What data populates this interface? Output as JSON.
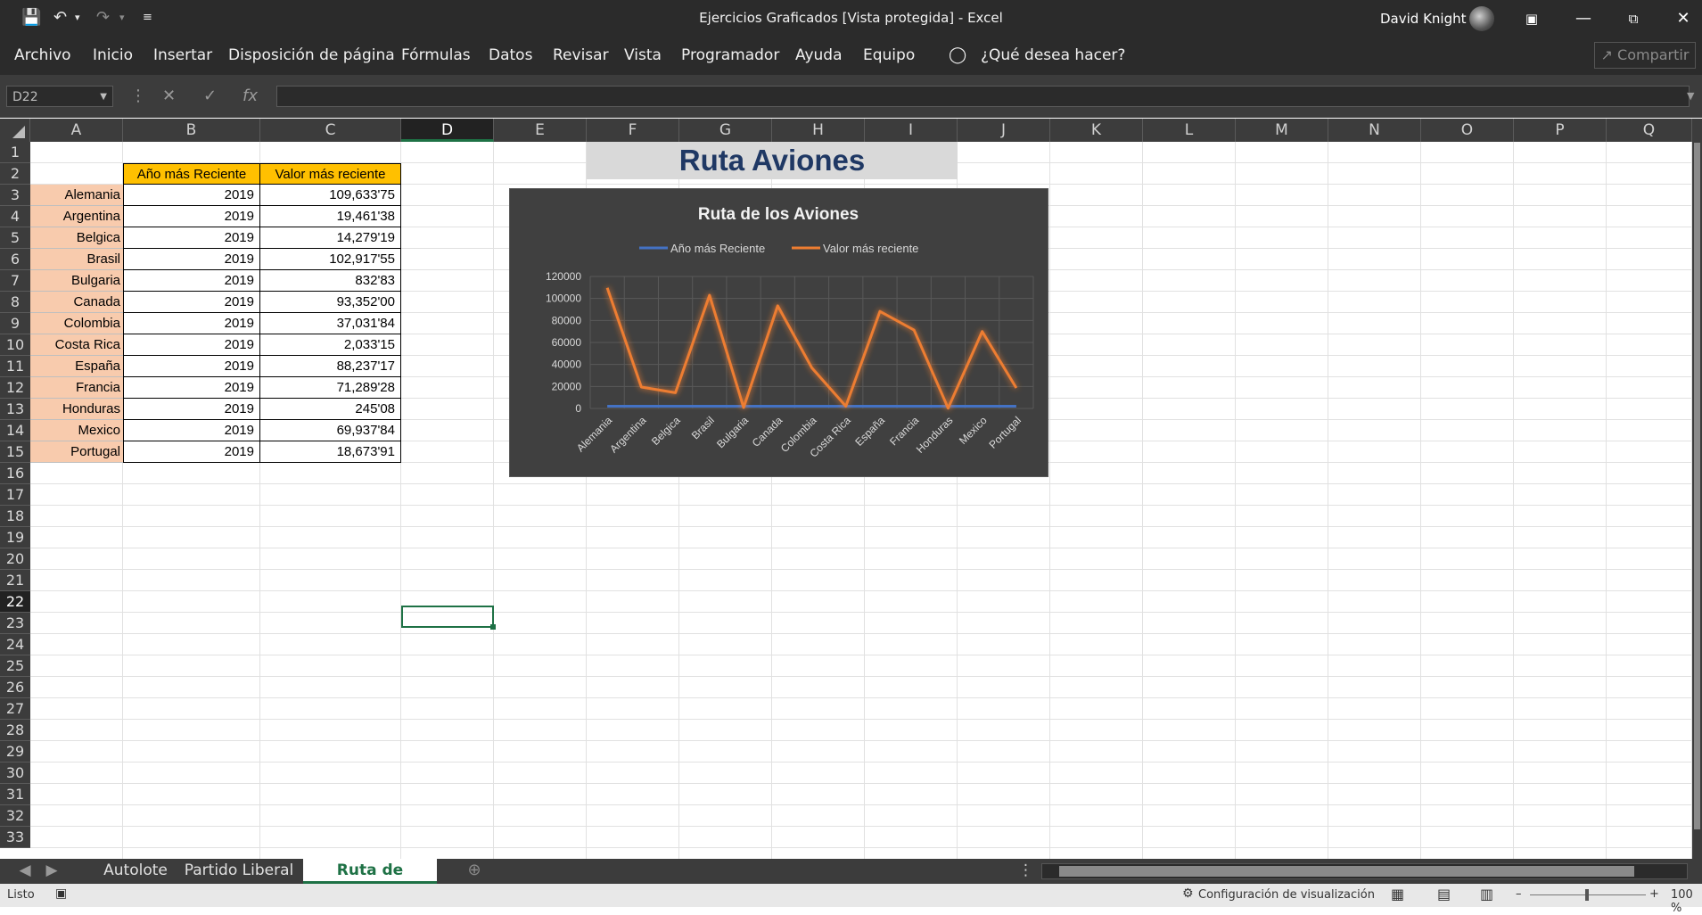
{
  "titlebar": {
    "title": "Ejercicios Graficados  [Vista protegida]  -  Excel",
    "user": "David Knight"
  },
  "menu": {
    "items": [
      "Archivo",
      "Inicio",
      "Insertar",
      "Disposición de página",
      "Fórmulas",
      "Datos",
      "Revisar",
      "Vista",
      "Programador",
      "Ayuda",
      "Equipo"
    ],
    "search": "¿Qué desea hacer?",
    "share": "Compartir"
  },
  "formula": {
    "namebox": "D22",
    "content": ""
  },
  "columns": [
    "A",
    "B",
    "C",
    "D",
    "E",
    "F",
    "G",
    "H",
    "I",
    "J",
    "K",
    "L",
    "M",
    "N",
    "O",
    "P",
    "Q"
  ],
  "rows": [
    "1",
    "2",
    "3",
    "4",
    "5",
    "6",
    "7",
    "8",
    "9",
    "10",
    "11",
    "12",
    "13",
    "14",
    "15",
    "16",
    "17",
    "18",
    "19",
    "20",
    "21",
    "22",
    "23",
    "24",
    "25",
    "26",
    "27",
    "28",
    "29",
    "30",
    "31",
    "32",
    "33"
  ],
  "sheet": {
    "title": "Ruta Aviones",
    "headers": [
      "Año más Reciente",
      "Valor más reciente"
    ],
    "rows": [
      {
        "country": "Alemania",
        "year": "2019",
        "value": "109,633'75"
      },
      {
        "country": "Argentina",
        "year": "2019",
        "value": "19,461'38"
      },
      {
        "country": "Belgica",
        "year": "2019",
        "value": "14,279'19"
      },
      {
        "country": "Brasil",
        "year": "2019",
        "value": "102,917'55"
      },
      {
        "country": "Bulgaria",
        "year": "2019",
        "value": "832'83"
      },
      {
        "country": "Canada",
        "year": "2019",
        "value": "93,352'00"
      },
      {
        "country": "Colombia",
        "year": "2019",
        "value": "37,031'84"
      },
      {
        "country": "Costa Rica",
        "year": "2019",
        "value": "2,033'15"
      },
      {
        "country": "España",
        "year": "2019",
        "value": "88,237'17"
      },
      {
        "country": "Francia",
        "year": "2019",
        "value": "71,289'28"
      },
      {
        "country": "Honduras",
        "year": "2019",
        "value": "245'08"
      },
      {
        "country": "Mexico",
        "year": "2019",
        "value": "69,937'84"
      },
      {
        "country": "Portugal",
        "year": "2019",
        "value": "18,673'91"
      }
    ]
  },
  "chart_data": {
    "type": "line",
    "title": "Ruta de los Aviones",
    "categories": [
      "Alemania",
      "Argentina",
      "Belgica",
      "Brasil",
      "Bulgaria",
      "Canada",
      "Colombia",
      "Costa Rica",
      "España",
      "Francia",
      "Honduras",
      "Mexico",
      "Portugal"
    ],
    "series": [
      {
        "name": "Año más Reciente",
        "color": "#4472c4",
        "values": [
          2019,
          2019,
          2019,
          2019,
          2019,
          2019,
          2019,
          2019,
          2019,
          2019,
          2019,
          2019,
          2019
        ]
      },
      {
        "name": "Valor más reciente",
        "color": "#ed7d31",
        "values": [
          109633.75,
          19461.38,
          14279.19,
          102917.55,
          832.83,
          93352.0,
          37031.84,
          2033.15,
          88237.17,
          71289.28,
          245.08,
          69937.84,
          18673.91
        ]
      }
    ],
    "yticks": [
      "0",
      "20000",
      "40000",
      "60000",
      "80000",
      "100000",
      "120000"
    ],
    "ylim": [
      0,
      120000
    ],
    "legend": "top",
    "grid": true
  },
  "tabs": [
    "Autolote",
    "Partido Liberal",
    "Ruta de aviones"
  ],
  "active_tab": "Ruta de aviones",
  "status": {
    "ready": "Listo",
    "display_settings": "Configuración de visualización",
    "zoom": "100 %"
  }
}
